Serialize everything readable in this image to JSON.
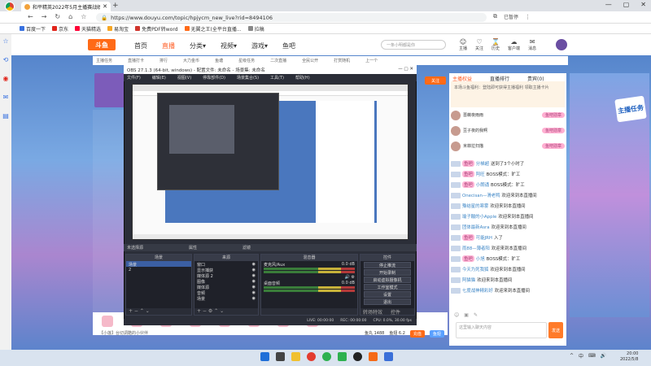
{
  "browser": {
    "tab_title": "和平精英2022年5月主播赛战绩第...",
    "new_tab": "+",
    "url": "https://www.douyu.com/topic/hpjycm_new_live?rid=8494106",
    "profile": "已暂停",
    "window_controls": [
      "—",
      "▢",
      "✕"
    ],
    "bookmarks": [
      "百度一下",
      "京东",
      "天猫精选",
      "易淘宝",
      "免费PDF转word",
      "无翼之王(全平台直播...",
      "拉稿"
    ]
  },
  "site": {
    "logo": "斗鱼",
    "nav": [
      "首页",
      "直播",
      "分类▾",
      "视频▾",
      "游戏▾",
      "鱼吧"
    ],
    "search_placeholder": "一条小明都是你",
    "head_icons": [
      {
        "icon": "☺",
        "label": "主播"
      },
      {
        "icon": "♡",
        "label": "关注"
      },
      {
        "icon": "⌛",
        "label": "历史"
      },
      {
        "icon": "☁",
        "label": "客户端"
      },
      {
        "icon": "✉",
        "label": "消息"
      }
    ],
    "subnav": [
      "主播任务",
      "直播打卡",
      "排行",
      "大力金币",
      "鱼塘",
      "星级任务",
      "二次直播",
      "全民公开",
      "打赏随机",
      "上一个"
    ],
    "follow": "关注"
  },
  "chat": {
    "tabs": [
      "主播权益",
      "直播排行",
      "贵宾(0)"
    ],
    "banner": "本场斗鱼福利：登陆即可获得主播福利 领取主播卡片",
    "ranks": [
      {
        "name": "蔷薇夜雨雨",
        "badge": "鱼吧勋章"
      },
      {
        "name": "豆子夜的我啊",
        "badge": "鱼吧勋章"
      },
      {
        "name": "米菲拉扫描",
        "badge": "鱼吧勋章"
      }
    ],
    "messages": [
      {
        "badge": "鱼吧",
        "user": "分梯超",
        "text": "送到了3个小时了"
      },
      {
        "badge": "鱼吧",
        "user": "阿旺",
        "text": "BOSS模式：旷工"
      },
      {
        "badge": "鱼吧",
        "user": "小朗诵",
        "text": "BOSS模式：旷工"
      },
      {
        "badge": "",
        "user": "Onecisan—滑老鸭",
        "text": "欢迎来到本直播间"
      },
      {
        "badge": "",
        "user": "豫结星的寒雾",
        "text": "欢迎来到本直播间"
      },
      {
        "badge": "",
        "user": "瑜子酸的小Apple",
        "text": "欢迎来到本直播间"
      },
      {
        "badge": "",
        "user": "团体最新Asra",
        "text": "欢迎来到本直播间"
      },
      {
        "badge": "鱼吧",
        "user": "可能JRH",
        "text": "入了"
      },
      {
        "badge": "",
        "user": "雨88—薄者阳",
        "text": "欢迎来到本直播间"
      },
      {
        "badge": "鱼吧",
        "user": "小旭",
        "text": "BOSS模式：旷工"
      },
      {
        "badge": "",
        "user": "今天为死我狐",
        "text": "欢迎来到本直播间"
      },
      {
        "badge": "",
        "user": "阿猫猫",
        "text": "欢迎来到本直播间"
      },
      {
        "badge": "",
        "user": "七度战神精彩好",
        "text": "欢迎来到本直播间"
      }
    ],
    "input_placeholder": "这里输入聊天内容",
    "send": "发送",
    "toolbar_icons": [
      "☺",
      "▣",
      "✎"
    ]
  },
  "right_badge": "主播任务",
  "gift": {
    "text": "【小莲】台切调酷的小伙伴",
    "right": [
      "鱼丸 1488",
      "鱼翅 6.2"
    ],
    "btn1": "充值",
    "btn2": "鱼翅"
  },
  "obs": {
    "title": "OBS 27.1.3 (64-bit, windows) - 配置文件: 未命名 - 场景集: 未命名",
    "menu": [
      "文件(F)",
      "编辑(E)",
      "视图(V)",
      "停靠部件(D)",
      "场景集合(S)",
      "工具(T)",
      "帮助(H)"
    ],
    "panel_header": [
      "未选择源",
      "属性",
      "滤镜"
    ],
    "docks": {
      "scenes_title": "场景",
      "scenes": [
        "场景",
        "2"
      ],
      "sources_title": "来源",
      "sources": [
        "窗口",
        "显示捕获",
        "媒体源 2",
        "图像",
        "媒体源",
        "音频",
        "场景"
      ],
      "mixer_title": "混音器",
      "mixer": [
        {
          "name": "麦克风/Aux",
          "db": "0.0 dB"
        },
        {
          "name": "桌面音频",
          "db": "0.0 dB"
        }
      ],
      "transitions_title": "转场",
      "controls_title": "控件",
      "controls": [
        "停止推流",
        "开始录制",
        "启动虚拟摄像机",
        "工作室模式",
        "设置",
        "退出"
      ],
      "controls_foot": [
        "转场特效",
        "控件"
      ]
    },
    "status": [
      "LIVE: 00:00:00",
      "REC: 00:00:00",
      "CPU: 0.0%, 30.00 fps"
    ]
  },
  "taskbar": {
    "tray": [
      "^",
      "中",
      "⌨",
      "🔊"
    ],
    "time": "20:00",
    "date": "2022/5/8"
  }
}
